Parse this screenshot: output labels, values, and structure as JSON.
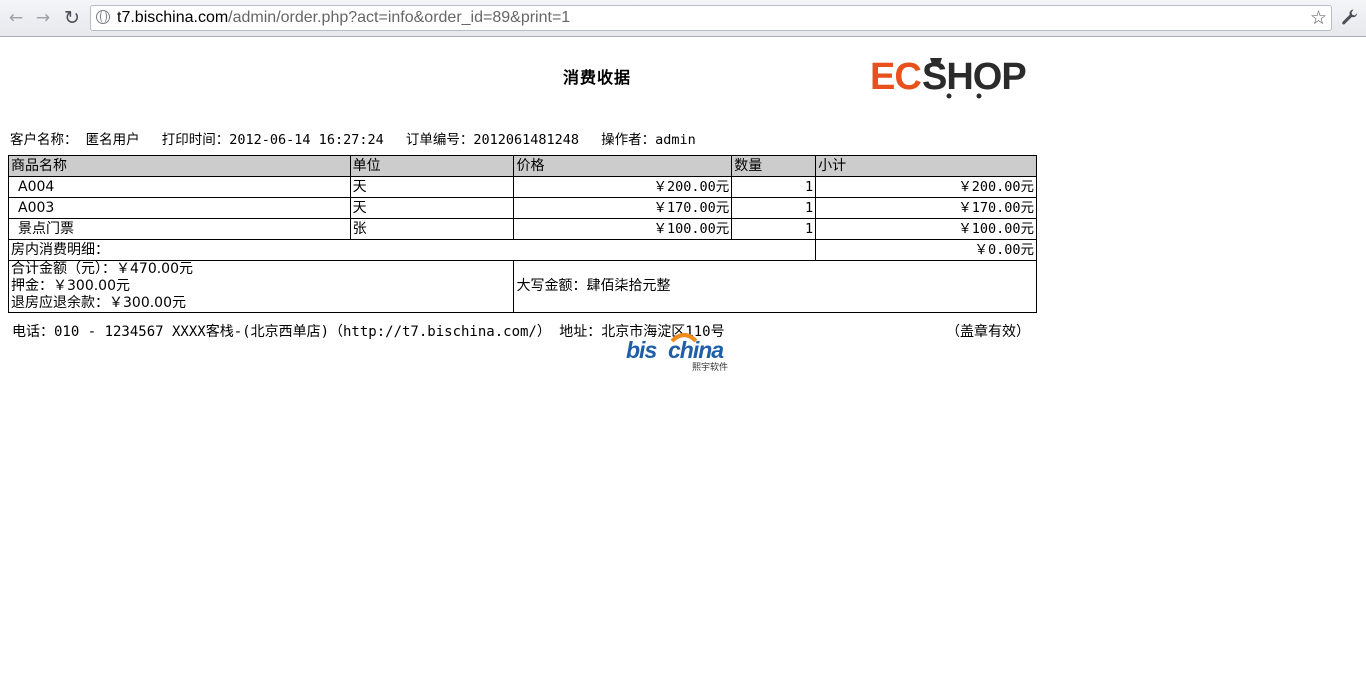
{
  "browser": {
    "url_host": "t7.bischina.com",
    "url_path": "/admin/order.php?act=info&order_id=89&print=1"
  },
  "receipt": {
    "title": "消费收据",
    "ecs_logo_text": "ECSHOP",
    "customer_label": "客户名称：",
    "customer_value": "匿名用户",
    "print_time_label": "打印时间：",
    "print_time_value": "2012-06-14 16:27:24",
    "order_no_label": "订单编号：",
    "order_no_value": "2012061481248",
    "operator_label": "操作者：",
    "operator_value": "admin",
    "columns": [
      "商品名称",
      "单位",
      "价格",
      "数量",
      "小计"
    ],
    "rows": [
      {
        "name": "A004",
        "unit": "天",
        "price": "￥200.00元",
        "qty": "1",
        "subtotal": "￥200.00元"
      },
      {
        "name": "A003",
        "unit": "天",
        "price": "￥170.00元",
        "qty": "1",
        "subtotal": "￥170.00元"
      },
      {
        "name": "景点门票",
        "unit": "张",
        "price": "￥100.00元",
        "qty": "1",
        "subtotal": "￥100.00元"
      }
    ],
    "room_detail_label": "房内消费明细：",
    "room_detail_value": "￥0.00元",
    "total_line": "合计金额（元）：￥470.00元",
    "deposit_line": "押金：￥300.00元",
    "refund_line": "退房应退余款：￥300.00元",
    "capital_amount": "大写金额：肆佰柒拾元整",
    "footer_contact": "电话：010 - 1234567 XXXX客栈-(北京西单店)（http://t7.bischina.com/） 地址：北京市海淀区110号",
    "footer_seal": "（盖章有效）",
    "bis_logo_text": "bischina",
    "bis_logo_sub": "熙宇软件"
  },
  "colors": {
    "header_bg": "#cccccc",
    "ecs_orange": "#e8501c",
    "ecs_dark": "#2b2b2b",
    "bis_blue": "#1e5fa8",
    "bis_orange": "#f08a1c"
  }
}
